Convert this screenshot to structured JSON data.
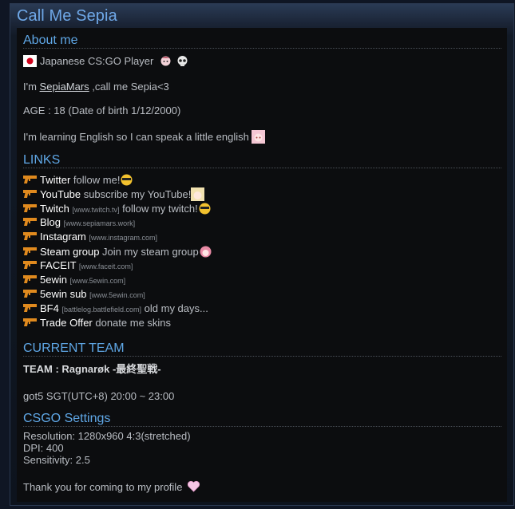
{
  "profile": {
    "title": "Call Me Sepia"
  },
  "about": {
    "heading": "About me",
    "line1": "Japanese CS:GO Player",
    "line2_prefix": "I'm ",
    "line2_name": "SepiaMars",
    "line2_suffix": " ,call me Sepia<3",
    "line3": "AGE : 18 (Date of birth 1/12/2000)",
    "line4": "I'm learning English so I can speak a little english"
  },
  "links": {
    "heading": "LINKS",
    "items": [
      {
        "name": "Twitter",
        "note": " follow me!",
        "domain": ""
      },
      {
        "name": "YouTube",
        "note": " subscribe my YouTube!",
        "domain": ""
      },
      {
        "name": "Twitch",
        "note": " follow my twitch!",
        "domain": "[www.twitch.tv]"
      },
      {
        "name": "Blog",
        "note": "",
        "domain": "[www.sepiamars.work]"
      },
      {
        "name": "Instagram",
        "note": "",
        "domain": "[www.instagram.com]"
      },
      {
        "name": "Steam group",
        "note": " Join my steam group",
        "domain": ""
      },
      {
        "name": "FACEIT",
        "note": "",
        "domain": "[www.faceit.com]"
      },
      {
        "name": "5ewin",
        "note": "",
        "domain": "[www.5ewin.com]"
      },
      {
        "name": "5ewin sub",
        "note": "",
        "domain": "[www.5ewin.com]"
      },
      {
        "name": "BF4",
        "note": " old my days...",
        "domain": "[battlelog.battlefield.com]"
      },
      {
        "name": "Trade Offer",
        "note": " donate me skins",
        "domain": ""
      }
    ]
  },
  "team": {
    "heading": "CURRENT TEAM",
    "label": "TEAM : ",
    "name": "Ragnarøk -最終聖戦-",
    "schedule": "got5 SGT(UTC+8) 20:00 ~ 23:00"
  },
  "csgo": {
    "heading": "CSGO Settings",
    "resolution": "Resolution: 1280x960 4:3(stretched)",
    "dpi": "DPI: 400",
    "sensitivity": "Sensitivity: 2.5",
    "thanks": "Thank you for coming to my profile"
  },
  "colors": {
    "accent": "#5fa7e6",
    "gun": "#e08a1e"
  }
}
